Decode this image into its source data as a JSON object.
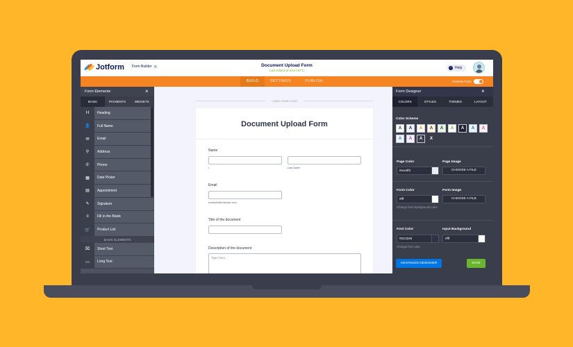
{
  "header": {
    "logo_text": "Jotform",
    "form_builder_label": "Form Builder",
    "doc_title": "Document Upload Form",
    "last_edited": "Last edited at 8:24 AM",
    "help_label": "Help"
  },
  "tabs": {
    "build": "BUILD",
    "settings": "SETTINGS",
    "publish": "PUBLISH"
  },
  "preview_label": "Preview Form",
  "left_panel": {
    "title": "Form Elements",
    "tabs": [
      "BASIC",
      "PAYMENTS",
      "WIDGETS"
    ],
    "items": [
      {
        "icon": "heading-icon",
        "glyph": "H",
        "label": "Heading"
      },
      {
        "icon": "user-icon",
        "glyph": "👤",
        "label": "Full Name"
      },
      {
        "icon": "email-icon",
        "glyph": "✉",
        "label": "Email"
      },
      {
        "icon": "location-icon",
        "glyph": "⚲",
        "label": "Address"
      },
      {
        "icon": "phone-icon",
        "glyph": "✆",
        "label": "Phone"
      },
      {
        "icon": "calendar-icon",
        "glyph": "▦",
        "label": "Date Picker"
      },
      {
        "icon": "appointment-icon",
        "glyph": "▤",
        "label": "Appointment"
      },
      {
        "icon": "signature-icon",
        "glyph": "✎",
        "label": "Signature"
      },
      {
        "icon": "fill-blank-icon",
        "glyph": "≡",
        "label": "Fill in the Blank"
      },
      {
        "icon": "cart-icon",
        "glyph": "🛒",
        "label": "Product List"
      }
    ],
    "section_label": "BASIC ELEMENTS",
    "items2": [
      {
        "icon": "short-text-icon",
        "glyph": "⌧",
        "label": "Short Text"
      },
      {
        "icon": "long-text-icon",
        "glyph": "▭",
        "label": "Long Text"
      }
    ]
  },
  "form": {
    "add_logo": "+ ADD YOUR LOGO",
    "title": "Document Upload Form",
    "name_label": "Name",
    "first_sub": "i",
    "last_sub": "Last Name",
    "email_label": "Email",
    "email_sub": "example@example.com",
    "doc_title_label": "Title of the document",
    "desc_label": "Description of the document",
    "desc_placeholder": "Type here..."
  },
  "right_panel": {
    "title": "Form Designer",
    "tabs": [
      "COLORS",
      "STYLES",
      "THEMES",
      "LAYOUT"
    ],
    "color_scheme_label": "Color Scheme",
    "swatches": [
      {
        "bg": "#FFFFFF",
        "fg": "#2C3345"
      },
      {
        "bg": "#F3F3FE",
        "fg": "#0A1551"
      },
      {
        "bg": "#FFFFFF",
        "fg": "#F58422"
      },
      {
        "bg": "#FFF3E0",
        "fg": "#2C3345"
      },
      {
        "bg": "#E8F5E1",
        "fg": "#2C3345"
      },
      {
        "bg": "#FFFFFF",
        "fg": "#6BB52E"
      },
      {
        "bg": "#1E2130",
        "fg": "#FFFFFF"
      },
      {
        "bg": "#EAF3FF",
        "fg": "#0075E3"
      },
      {
        "bg": "#FFF0F4",
        "fg": "#E04A7A"
      },
      {
        "bg": "#EEF6FF",
        "fg": "#2C7BD9"
      },
      {
        "bg": "#F6EEFF",
        "fg": "#8A4FD1"
      },
      {
        "bg": "#3A3E4B",
        "fg": "#FFFFFF"
      }
    ],
    "swatch_letter": "A",
    "swatch_close": "X",
    "page_color_label": "Page Color",
    "page_color_value": "#ecedf3",
    "page_color_chip": "#ECEDF3",
    "page_image_label": "Page Image",
    "choose_file": "CHOOSE A FILE",
    "form_color_label": "Form Color",
    "form_color_value": "#fff",
    "form_color_hint": "Change form background color",
    "form_image_label": "Form Image",
    "font_color_label": "Font Color",
    "font_color_value": "#2C3345",
    "font_color_hint": "Change font color",
    "input_bg_label": "Input Background",
    "input_bg_value": "#fff",
    "advanced_designer": "ADVANCED DESIGNER",
    "save": "SAVE"
  },
  "colors": {
    "background": "#FFB629",
    "orange": "#F58422",
    "navy": "#0A1551",
    "panel_dark": "#3A3E4B",
    "blue": "#0075E3",
    "green": "#6BB52E"
  }
}
